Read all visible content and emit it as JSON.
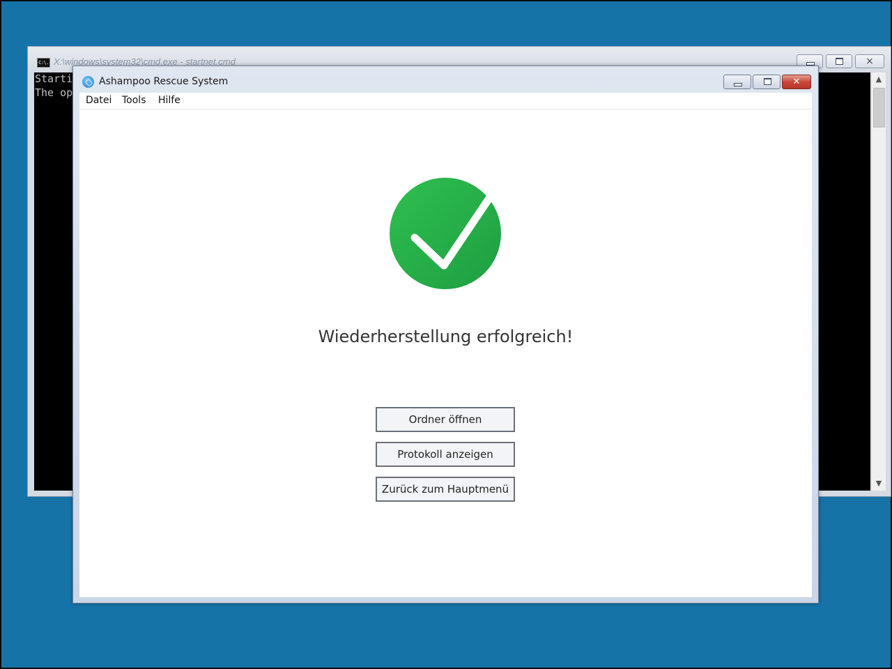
{
  "cmd_window": {
    "title": "X:\\windows\\system32\\cmd.exe - startnet.cmd",
    "icon_text": "C:\\.",
    "lines": [
      "Starti",
      "The op"
    ],
    "controls": {
      "minimize": "minimize-icon",
      "maximize": "maximize-icon",
      "close": "×"
    }
  },
  "app_window": {
    "title": "Ashampoo Rescue System",
    "icon": "ashampoo-logo-icon",
    "controls": {
      "minimize": "minimize-icon",
      "maximize": "maximize-icon",
      "close": "✕"
    }
  },
  "menu": {
    "items": [
      {
        "label": "Datei"
      },
      {
        "label": "Tools"
      },
      {
        "label": "Hilfe"
      }
    ]
  },
  "main": {
    "status_icon": "checkmark-circle-icon",
    "status_color": "#23b04b",
    "message": "Wiederherstellung erfolgreich!",
    "buttons": [
      {
        "label": "Ordner öffnen"
      },
      {
        "label": "Protokoll anzeigen"
      },
      {
        "label": "Zurück zum Hauptmenü"
      }
    ]
  },
  "colors": {
    "desktop": "#1673a8",
    "console_bg": "#000000",
    "console_text": "#c0c0c0",
    "close_button": "#c8473a"
  }
}
